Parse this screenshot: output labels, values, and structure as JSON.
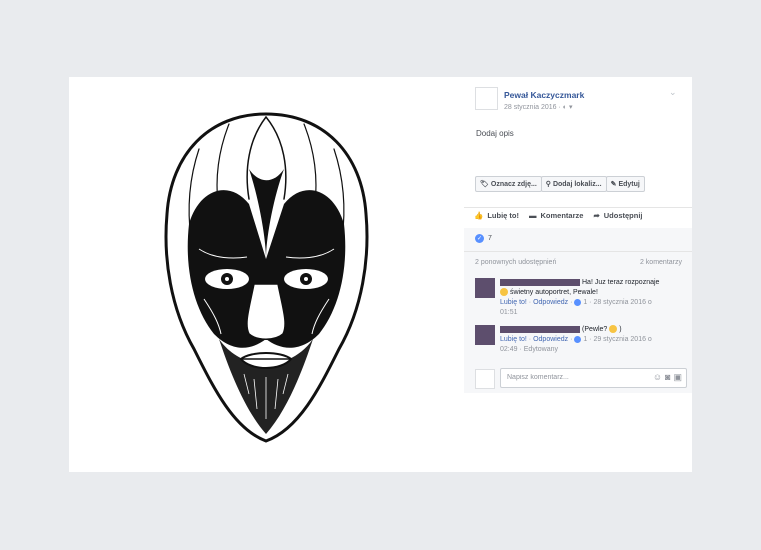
{
  "post": {
    "author": "Pewał Kaczyczmark",
    "date": "28 stycznia 2016",
    "privacy_icon": "globe-icon",
    "description": "Dodaj opis"
  },
  "photo_tools": [
    {
      "icon": "tag-icon",
      "label": "Oznacz zdję..."
    },
    {
      "icon": "location-pin-icon",
      "label": "Dodaj lokaliz..."
    },
    {
      "icon": "pencil-icon",
      "label": "Edytuj"
    }
  ],
  "actions": {
    "like": "Lubię to!",
    "comment": "Komentarze",
    "share": "Udostępnij"
  },
  "reactions": {
    "count": "7"
  },
  "stats": {
    "shares": "2 ponownych udostępnień",
    "comments": "2 komentarzy"
  },
  "comments": [
    {
      "text_a": "Ha! Juz teraz rozpoznaje",
      "text_b": "świetny autoportret, Pewale!",
      "like": "Lubię to!",
      "reply": "Odpowiedz",
      "likes": "1",
      "time_a": "28 stycznia 2016 o",
      "time_b": "01:51",
      "edited": ""
    },
    {
      "text_a": "(Pewle?",
      "text_b": ")",
      "like": "Lubię to!",
      "reply": "Odpowiedz",
      "likes": "1",
      "time_a": "29 stycznia 2016 o",
      "time_b": "02:49",
      "edited": "Edytowany"
    }
  ],
  "composer": {
    "placeholder": "Napisz komentarz..."
  },
  "colors": {
    "link": "#365899",
    "accent": "#4267b2",
    "bg": "#e9ebee"
  }
}
